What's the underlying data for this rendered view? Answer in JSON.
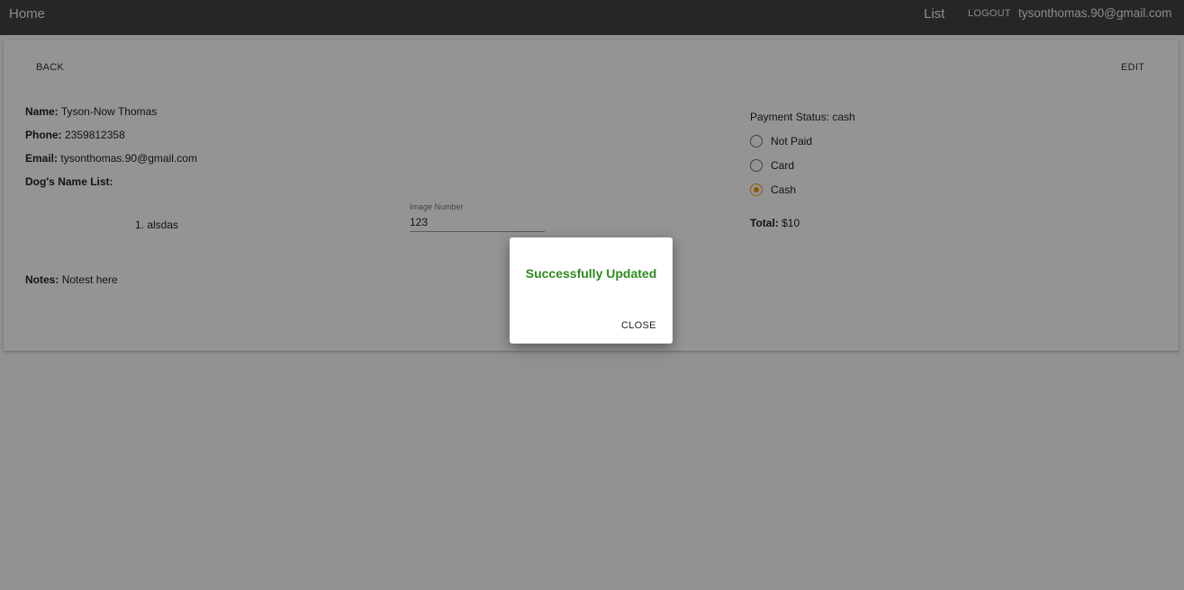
{
  "topbar": {
    "home": "Home",
    "list": "List",
    "logout": "LOGOUT",
    "user_email": "tysonthomas.90@gmail.com"
  },
  "card": {
    "back_label": "BACK",
    "edit_label": "EDIT",
    "name_label": "Name:",
    "name_value": "Tyson-Now Thomas",
    "phone_label": "Phone:",
    "phone_value": "2359812358",
    "email_label": "Email:",
    "email_value": "tysonthomas.90@gmail.com",
    "dogs_label": "Dog's Name List:",
    "dogs": [
      "1. alsdas"
    ],
    "image_number_label": "Image Number",
    "image_number_value": "123",
    "notes_label": "Notes:",
    "notes_value": "Notest here",
    "payment_status": "Payment Status: cash",
    "payment_options": [
      {
        "label": "Not Paid",
        "selected": false
      },
      {
        "label": "Card",
        "selected": false
      },
      {
        "label": "Cash",
        "selected": true
      }
    ],
    "total_label": "Total:",
    "total_value": "$10",
    "accent_color": "#ff9800"
  },
  "dialog": {
    "message": "Successfully Updated",
    "close_label": "CLOSE",
    "message_color": "#2e8b1e"
  }
}
